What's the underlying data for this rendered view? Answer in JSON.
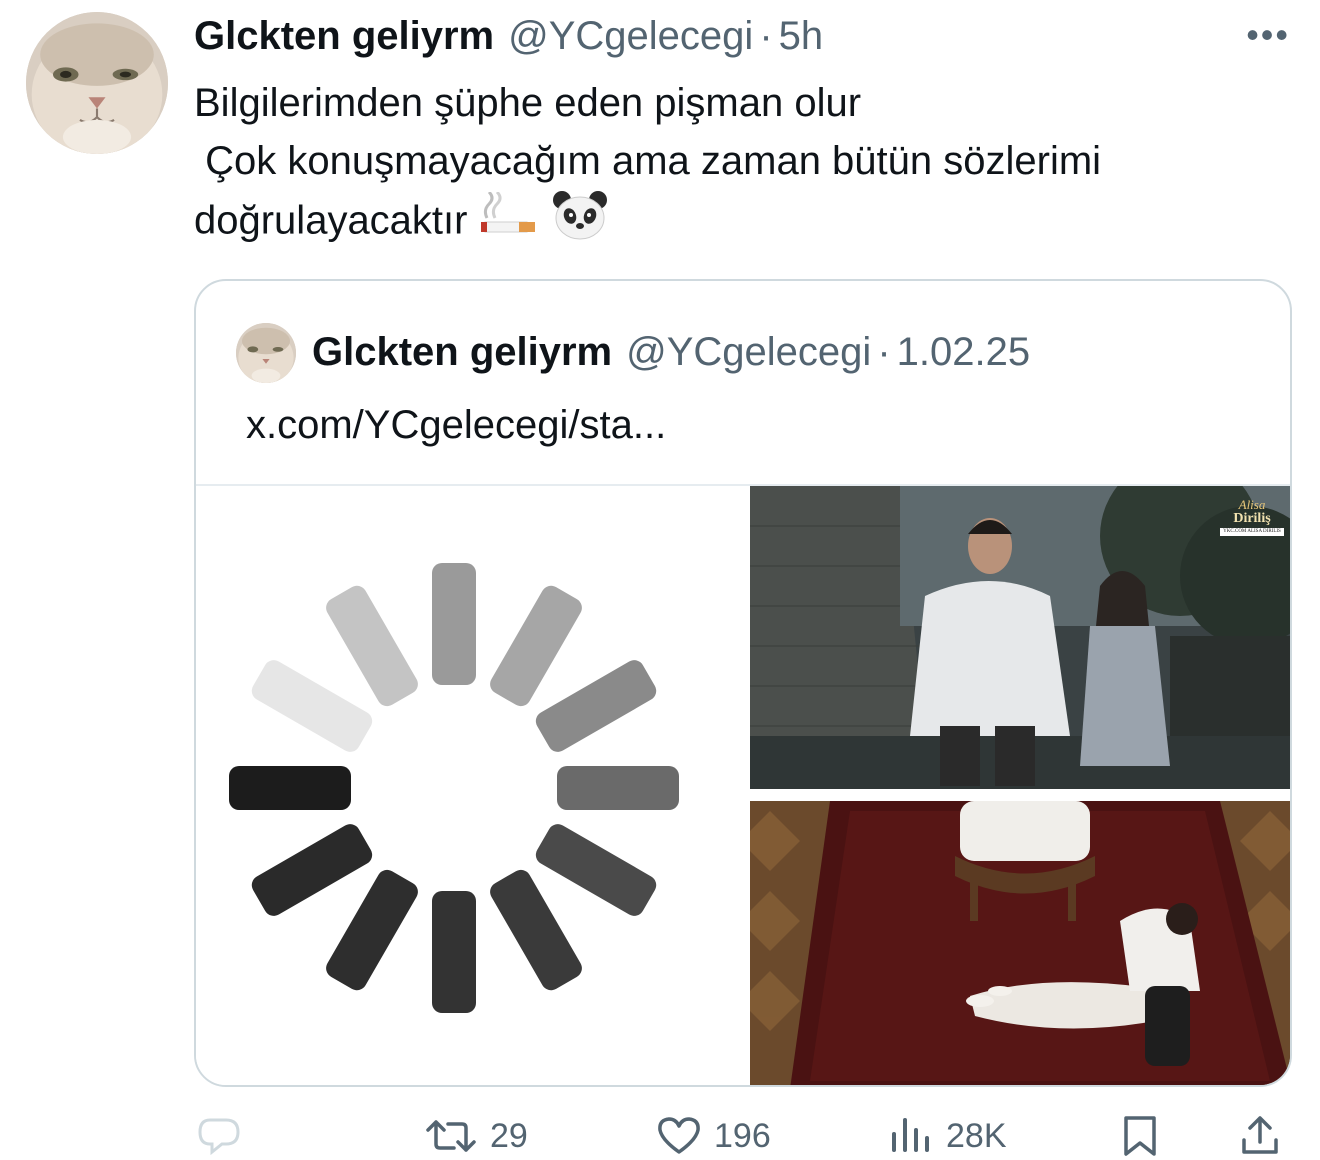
{
  "tweet": {
    "author_name": "Glckten geliyrm",
    "handle": "@YCgelecegi",
    "separator": "·",
    "time": "5h",
    "text_lines": [
      "Bilgilerimden şüphe eden pişman olur",
      " Çok konuşmayacağım ama zaman bütün sözlerimi",
      "doğrulayacaktır"
    ],
    "emojis": [
      "smoking-emoji",
      "panda-face-emoji"
    ],
    "more_icon": "more-horizontal-icon"
  },
  "quote": {
    "author_name": "Glckten geliyrm",
    "handle": "@YCgelecegi",
    "separator": "·",
    "date": "1.02.25",
    "link_text": "x.com/YCgelecegi/sta...",
    "overlay_logo": {
      "line1": "Alisa",
      "line2": "Diriliş",
      "line3": "YKC.COM ALISA DIRILIS"
    }
  },
  "actions": {
    "reply": {
      "icon": "reply-icon",
      "count": ""
    },
    "retweet": {
      "icon": "retweet-icon",
      "count": "29"
    },
    "like": {
      "icon": "heart-icon",
      "count": "196"
    },
    "views": {
      "icon": "views-bar-chart-icon",
      "count": "28K"
    },
    "bookmark": {
      "icon": "bookmark-icon"
    },
    "share": {
      "icon": "share-icon"
    }
  },
  "colors": {
    "text_primary": "#0f1419",
    "text_secondary": "#536471",
    "border": "#cfd9de"
  }
}
